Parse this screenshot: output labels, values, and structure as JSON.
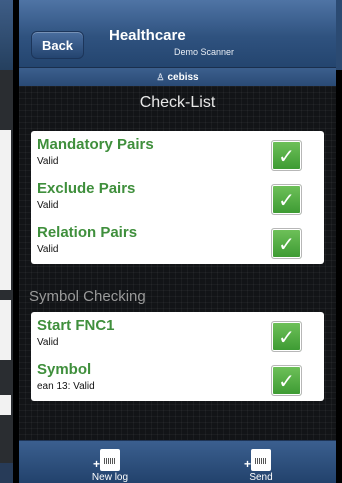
{
  "header": {
    "back_label": "Back",
    "app_title": "Healthcare",
    "app_subtitle": "Demo Scanner"
  },
  "userbar": {
    "user_name": "cebiss",
    "icon": "user-icon"
  },
  "page": {
    "title": "Check-List"
  },
  "groups": [
    {
      "items": [
        {
          "title": "Mandatory Pairs",
          "status": "Valid",
          "checked": true
        },
        {
          "title": "Exclude Pairs",
          "status": "Valid",
          "checked": true
        },
        {
          "title": "Relation Pairs",
          "status": "Valid",
          "checked": true
        }
      ]
    },
    {
      "label": "Symbol Checking",
      "items": [
        {
          "title": "Start FNC1",
          "status": "Valid",
          "checked": true
        },
        {
          "title": "Symbol",
          "status": "ean 13: Valid",
          "checked": true
        }
      ]
    }
  ],
  "tabbar": {
    "new_log_label": "New log",
    "send_label": "Send",
    "new_log_icon": "new-log-icon",
    "send_icon": "send-icon"
  },
  "colors": {
    "header_blue": "#2f527f",
    "item_title_green": "#3f8f3c",
    "check_green": "#4aa83c"
  }
}
